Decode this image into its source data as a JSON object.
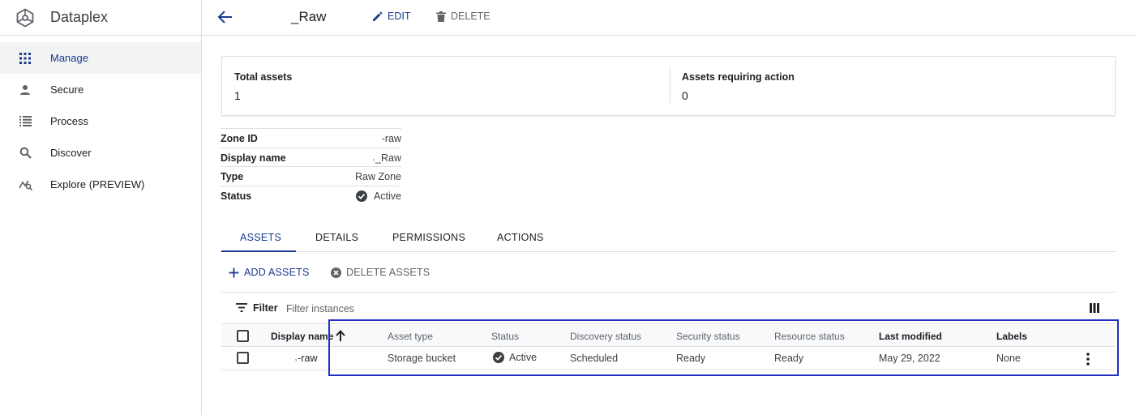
{
  "app": {
    "title": "Dataplex"
  },
  "sidebar": {
    "items": [
      {
        "label": "Manage",
        "icon": "grid-icon",
        "active": true
      },
      {
        "label": "Secure",
        "icon": "person-icon"
      },
      {
        "label": "Process",
        "icon": "list-icon"
      },
      {
        "label": "Discover",
        "icon": "search-icon"
      },
      {
        "label": "Explore (PREVIEW)",
        "icon": "explore-icon"
      }
    ]
  },
  "header": {
    "title": "_Raw",
    "edit_label": "EDIT",
    "delete_label": "DELETE"
  },
  "summary": {
    "total_assets_label": "Total assets",
    "total_assets_value": "1",
    "assets_requiring_action_label": "Assets requiring action",
    "assets_requiring_action_value": "0"
  },
  "properties": {
    "zone_id_label": "Zone ID",
    "zone_id_value": "-raw",
    "display_name_label": "Display name",
    "display_name_value": "˒_Raw",
    "type_label": "Type",
    "type_value": "Raw Zone",
    "status_label": "Status",
    "status_value": "Active"
  },
  "tabs": [
    {
      "label": "ASSETS",
      "active": true
    },
    {
      "label": "DETAILS"
    },
    {
      "label": "PERMISSIONS"
    },
    {
      "label": "ACTIONS"
    }
  ],
  "actions": {
    "add_label": "ADD ASSETS",
    "delete_label": "DELETE ASSETS"
  },
  "filter": {
    "label": "Filter",
    "placeholder": "Filter instances"
  },
  "table": {
    "headers": {
      "display_name": "Display name",
      "asset_type": "Asset type",
      "status": "Status",
      "discovery_status": "Discovery status",
      "security_status": "Security status",
      "resource_status": "Resource status",
      "last_modified": "Last modified",
      "labels": "Labels"
    },
    "rows": [
      {
        "display_name": "˒-raw",
        "asset_type": "Storage bucket",
        "status": "Active",
        "discovery_status": "Scheduled",
        "security_status": "Ready",
        "resource_status": "Ready",
        "last_modified": "May 29, 2022",
        "labels": "None"
      }
    ]
  },
  "colors": {
    "accent": "#1a3a8f",
    "highlight_box": "#1f2fbf",
    "border": "#dadce0"
  }
}
